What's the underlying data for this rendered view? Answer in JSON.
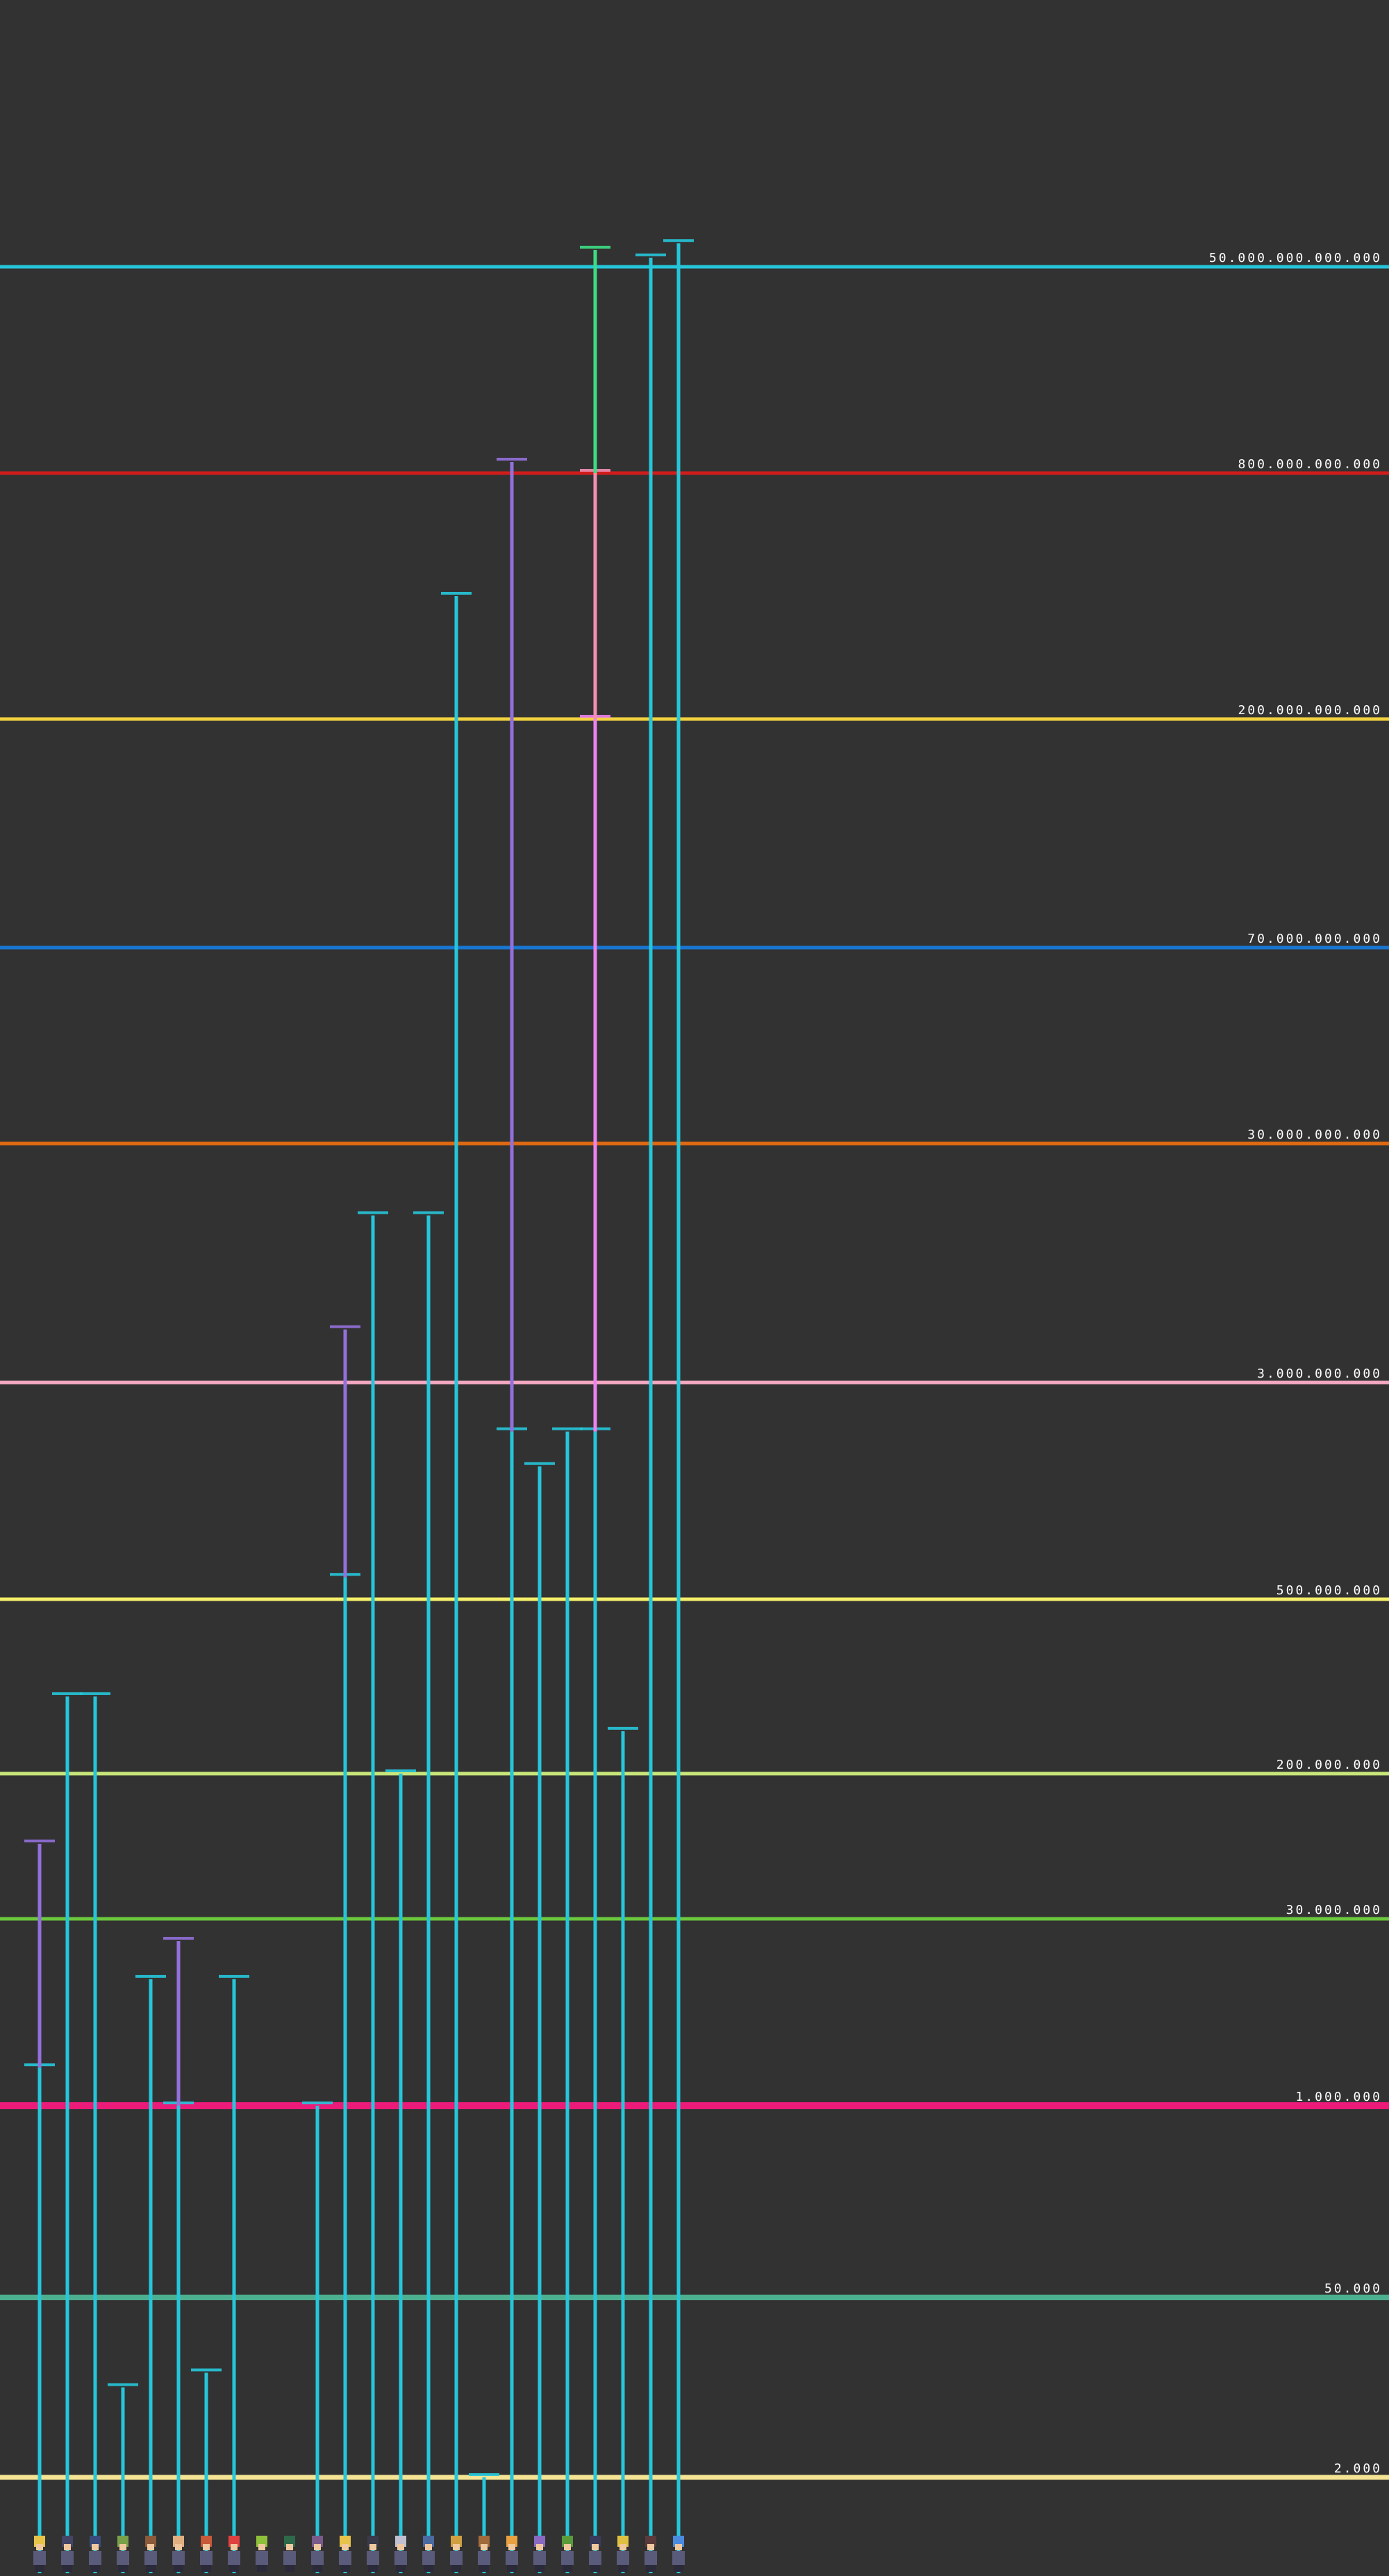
{
  "chart_data": {
    "type": "bar",
    "scale": "log",
    "grid": false,
    "legend": "none",
    "reference_lines": [
      {
        "label": "50.000.000.000.000",
        "value": 50000000000000,
        "color": "#26c6da"
      },
      {
        "label": "800.000.000.000",
        "value": 800000000000,
        "color": "#d21c1c"
      },
      {
        "label": "200.000.000.000",
        "value": 200000000000,
        "color": "#f2d33f"
      },
      {
        "label": "70.000.000.000",
        "value": 70000000000,
        "color": "#1976d2"
      },
      {
        "label": "30.000.000.000",
        "value": 30000000000,
        "color": "#e06a12"
      },
      {
        "label": "3.000.000.000",
        "value": 3000000000,
        "color": "#f4a8c2"
      },
      {
        "label": "500.000.000",
        "value": 500000000,
        "color": "#f5ef6a"
      },
      {
        "label": "200.000.000",
        "value": 200000000,
        "color": "#c8e67a"
      },
      {
        "label": "30.000.000",
        "value": 30000000,
        "color": "#6cc83c"
      },
      {
        "label": "1.000.000",
        "value": 1000000,
        "color": "#ec1a79"
      },
      {
        "label": "50.000",
        "value": 50000,
        "color": "#4cb090"
      },
      {
        "label": "2.000",
        "value": 2000,
        "color": "#f5e494"
      }
    ],
    "characters": [
      {
        "icon": "blonde-warrior-sprite",
        "color": "#e8c34a",
        "stages": [
          {
            "value": 2000000,
            "color": "#26c6da"
          },
          {
            "value": 80000000,
            "color": "#9370db"
          }
        ]
      },
      {
        "icon": "dark-hair-fighter-sprite",
        "color": "#444466",
        "stages": [
          {
            "value": 300000000,
            "color": "#26c6da"
          }
        ]
      },
      {
        "icon": "dark-hair-fighter-sprite",
        "color": "#3b4a7a",
        "stages": [
          {
            "value": 300000000,
            "color": "#26c6da"
          }
        ]
      },
      {
        "icon": "green-fighter-sprite",
        "color": "#7aa04a",
        "stages": [
          {
            "value": 10000,
            "color": "#26c6da"
          }
        ]
      },
      {
        "icon": "brown-fighter-sprite",
        "color": "#8a5a3a",
        "stages": [
          {
            "value": 10000000,
            "color": "#26c6da"
          }
        ]
      },
      {
        "icon": "bald-monk-sprite",
        "color": "#e0b080",
        "stages": [
          {
            "value": 1000000,
            "color": "#26c6da"
          },
          {
            "value": 20000000,
            "color": "#9370db"
          }
        ]
      },
      {
        "icon": "red-hair-fighter-sprite",
        "color": "#c85a3a",
        "stages": [
          {
            "value": 13000,
            "color": "#26c6da"
          }
        ]
      },
      {
        "icon": "white-robed-sprite",
        "color": "#e04040",
        "stages": [
          {
            "value": 10000000,
            "color": "#26c6da"
          }
        ]
      },
      {
        "icon": "green-monster-sprite",
        "color": "#8fc03a",
        "stages": []
      },
      {
        "icon": "green-dragon-sprite",
        "color": "#2e6a4a",
        "stages": []
      },
      {
        "icon": "tall-warrior-sprite",
        "color": "#7a5a8a",
        "stages": [
          {
            "value": 1000000,
            "color": "#26c6da"
          }
        ]
      },
      {
        "icon": "blonde-warrior-sprite",
        "color": "#e8c34a",
        "stages": [
          {
            "value": 600000000,
            "color": "#26c6da"
          },
          {
            "value": 5000000000,
            "color": "#9370db"
          }
        ]
      },
      {
        "icon": "spiky-hair-sprite",
        "color": "#3a3a4a",
        "stages": [
          {
            "value": 15000000000,
            "color": "#26c6da"
          }
        ]
      },
      {
        "icon": "silver-hair-sprite",
        "color": "#c0c0d0",
        "stages": [
          {
            "value": 200000000,
            "color": "#26c6da"
          }
        ]
      },
      {
        "icon": "armored-warrior-sprite",
        "color": "#4a6aa0",
        "stages": [
          {
            "value": 15000000000,
            "color": "#26c6da"
          }
        ]
      },
      {
        "icon": "golden-warrior-sprite",
        "color": "#d0a040",
        "stages": [
          {
            "value": 400000000000,
            "color": "#26c6da"
          }
        ]
      },
      {
        "icon": "small-fighter-sprite",
        "color": "#a06a3a",
        "stages": [
          {
            "value": 2000,
            "color": "#26c6da"
          }
        ]
      },
      {
        "icon": "orange-hair-sprite",
        "color": "#e8a040",
        "stages": [
          {
            "value": 2000000000,
            "color": "#26c6da"
          },
          {
            "value": 1000000000000,
            "color": "#9370db"
          }
        ]
      },
      {
        "icon": "purple-alien-sprite",
        "color": "#8a6ac0",
        "stages": [
          {
            "value": 1500000000,
            "color": "#26c6da"
          }
        ]
      },
      {
        "icon": "green-insect-sprite",
        "color": "#5a9a3a",
        "stages": [
          {
            "value": 2000000000,
            "color": "#26c6da"
          }
        ]
      },
      {
        "icon": "black-hair-saiyan-sprite",
        "color": "#3a3a5a",
        "stages": [
          {
            "value": 2000000000,
            "color": "#26c6da"
          },
          {
            "value": 200000000000,
            "color": "#ee82ee"
          },
          {
            "value": 800000000000,
            "color": "#f48fb1"
          },
          {
            "value": 70000000000000,
            "color": "#3ddc84"
          }
        ]
      },
      {
        "icon": "blonde-fighter-sprite",
        "color": "#e0c040",
        "stages": [
          {
            "value": 250000000,
            "color": "#26c6da"
          }
        ]
      },
      {
        "icon": "long-hair-warrior-sprite",
        "color": "#5a3a3a",
        "stages": [
          {
            "value": 60000000000000,
            "color": "#26c6da"
          }
        ]
      },
      {
        "icon": "blue-dragon-sprite",
        "color": "#4a8ae0",
        "stages": [
          {
            "value": 80000000000000,
            "color": "#26c6da"
          }
        ]
      }
    ]
  }
}
